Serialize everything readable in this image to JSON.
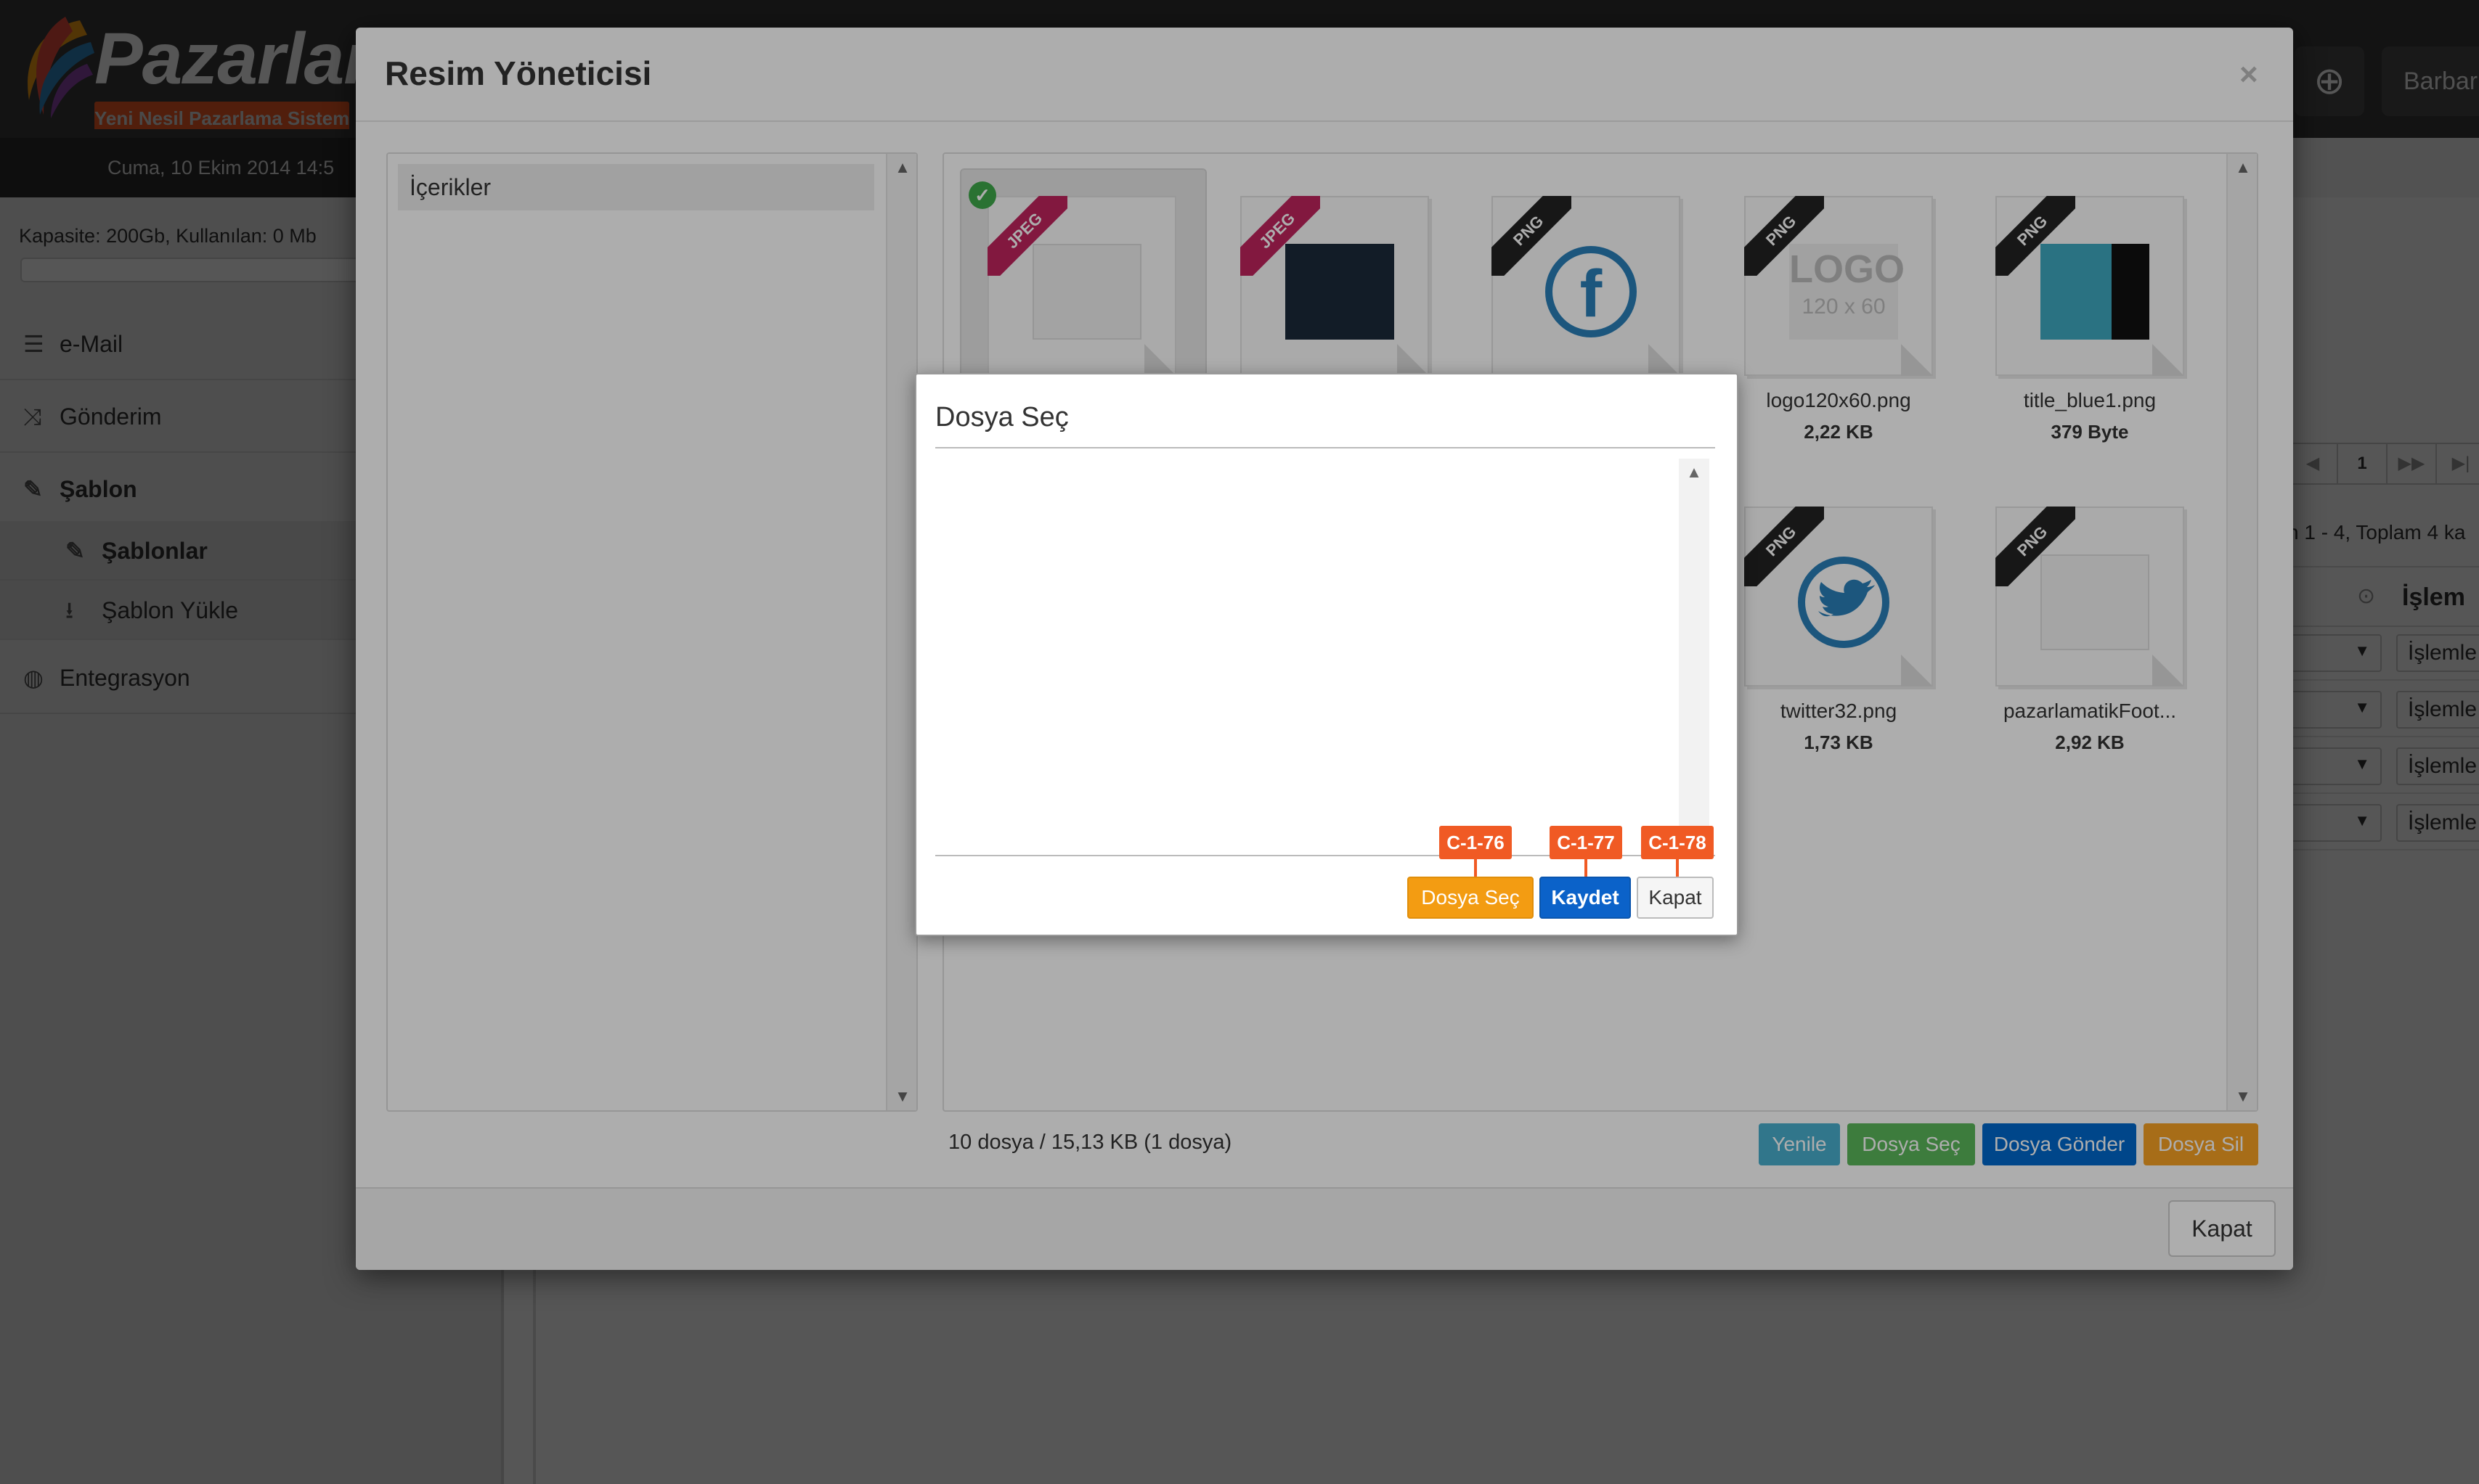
{
  "app": {
    "brand": "Pazarlama",
    "tagline": "Yeni Nesil Pazarlama Sistem",
    "date": "Cuma, 10 Ekim 2014 14:5",
    "capacity": "Kapasite: 200Gb, Kullanılan: 0 Mb",
    "user": "Barbar",
    "nav": [
      {
        "label": "e-Mail",
        "icon": "list-icon"
      },
      {
        "label": "Gönderim",
        "icon": "shuffle-icon"
      },
      {
        "label": "Şablon",
        "icon": "pencil-icon"
      },
      {
        "label": "Şablonlar",
        "icon": "pencil-icon"
      },
      {
        "label": "Şablon Yükle",
        "icon": "upload-icon"
      },
      {
        "label": "Entegrasyon",
        "icon": "globe-icon"
      }
    ],
    "pager_current": "1",
    "range_text": "n 1 - 4, Toplam 4 ka",
    "table_action_header": "İşlem",
    "row_action_label": "İşlemle"
  },
  "modal": {
    "title": "Resim Yöneticisi",
    "close_symbol": "×",
    "tree_root": "İçerikler",
    "files": [
      {
        "ext": "JPEG",
        "name": "",
        "size": ""
      },
      {
        "ext": "JPEG",
        "name": "",
        "size": ""
      },
      {
        "ext": "PNG",
        "name": "",
        "size": ""
      },
      {
        "ext": "PNG",
        "name": "logo120x60.png",
        "size": "2,22 KB"
      },
      {
        "ext": "PNG",
        "name": "title_blue1.png",
        "size": "379 Byte"
      },
      {
        "ext": "PNG",
        "name": "twitter32.png",
        "size": "1,73 KB"
      },
      {
        "ext": "PNG",
        "name": "pazarlamatikFoot...",
        "size": "2,92 KB"
      }
    ],
    "logo_thumb_text": "LOGO",
    "logo_thumb_sub": "120 x 60",
    "status": "10 dosya / 15,13 KB   (1 dosya)",
    "buttons": {
      "refresh": "Yenile",
      "choose": "Dosya Seç",
      "send": "Dosya Gönder",
      "delete": "Dosya Sil",
      "close": "Kapat"
    }
  },
  "dialog": {
    "title": "Dosya Seç",
    "buttons": {
      "choose": "Dosya Seç",
      "save": "Kaydet",
      "close": "Kapat"
    },
    "tags": [
      "C-1-76",
      "C-1-77",
      "C-1-78"
    ]
  },
  "colors": {
    "accent_orange": "#f39c12",
    "accent_blue": "#0b62c9",
    "tag_red": "#f05a24",
    "jpeg_ribbon": "#c0245e",
    "png_ribbon": "#222222"
  }
}
